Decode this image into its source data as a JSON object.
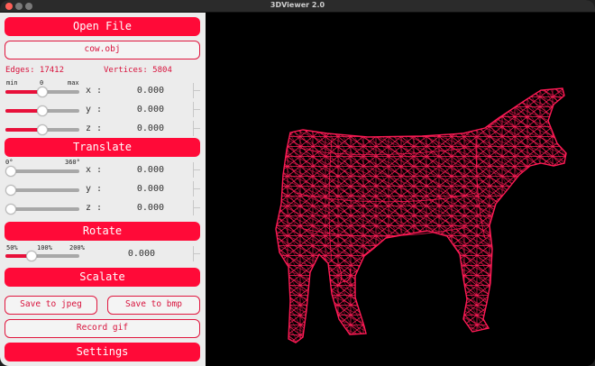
{
  "window": {
    "title": "3DViewer 2.0"
  },
  "file": {
    "open_label": "Open File",
    "filename": "cow.obj"
  },
  "stats": {
    "edges": "Edges: 17412",
    "vertices": "Vertices: 5804"
  },
  "translate": {
    "range_min": "min",
    "range_mid": "0",
    "range_max": "max",
    "rows": [
      {
        "axis": "x :",
        "value": "0.000",
        "level": 0.5
      },
      {
        "axis": "y :",
        "value": "0.000",
        "level": 0.5
      },
      {
        "axis": "z :",
        "value": "0.000",
        "level": 0.5
      }
    ],
    "button": "Translate"
  },
  "rotate": {
    "range_min": "0°",
    "range_max": "360°",
    "rows": [
      {
        "axis": "x :",
        "value": "0.000",
        "level": 0
      },
      {
        "axis": "y :",
        "value": "0.000",
        "level": 0
      },
      {
        "axis": "z :",
        "value": "0.000",
        "level": 0
      }
    ],
    "button": "Rotate"
  },
  "scale": {
    "min": "50%",
    "mid": "100%",
    "max": "200%",
    "value": "0.000",
    "level": 0.33,
    "button": "Scalate"
  },
  "actions": {
    "save_jpeg": "Save to jpeg",
    "save_bmp": "Save to bmp",
    "record_gif": "Record gif",
    "settings": "Settings"
  },
  "colors": {
    "accent": "#ff0a38",
    "wire": "#ff1a55",
    "viewport_bg": "#000000",
    "panel_bg": "#ececec"
  }
}
